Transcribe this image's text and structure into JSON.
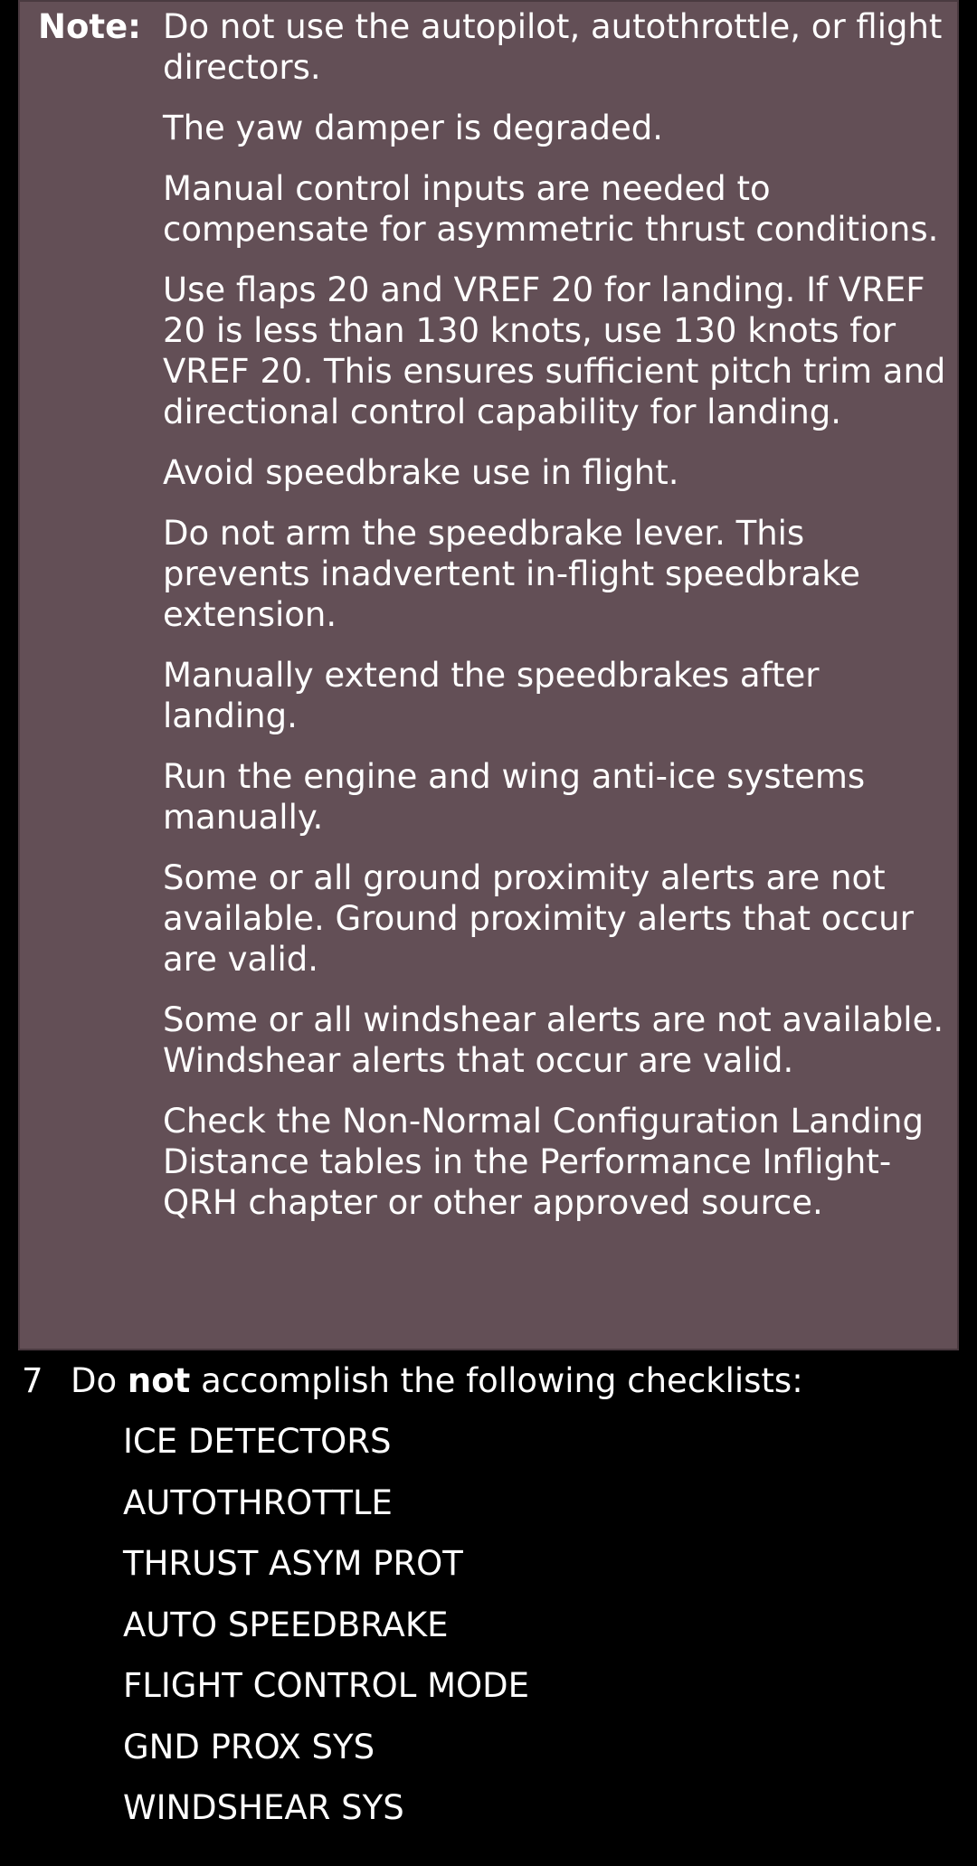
{
  "note": {
    "label": "Note:",
    "items": [
      "Do not use the autopilot, autothrottle, or flight directors.",
      "The yaw damper is degraded.",
      "Manual control inputs are needed to compensate for asymmetric thrust conditions.",
      "Use flaps 20 and VREF 20 for landing. If VREF 20 is less than 130 knots, use 130 knots for VREF 20. This ensures sufficient pitch trim and directional control capability for landing.",
      "Avoid speedbrake use in flight.",
      "Do not arm the speedbrake lever. This prevents inadvertent in-flight speedbrake extension.",
      "Manually extend the speedbrakes after landing.",
      "Run the engine and wing anti-ice systems manually.",
      "Some or all ground proximity alerts are not available. Ground proximity alerts that occur are valid.",
      "Some or all windshear alerts are not available. Windshear alerts that occur are valid.",
      "Check the Non-Normal Configuration Landing Distance tables in the Performance Inflight-QRH chapter or other approved source."
    ]
  },
  "step7": {
    "number": "7",
    "text_before": "Do ",
    "emphasis": "not",
    "text_after": " accomplish the following checklists:",
    "checklists": [
      "ICE DETECTORS",
      "AUTOTHROTTLE",
      "THRUST ASYM PROT",
      "AUTO SPEEDBRAKE",
      "FLIGHT CONTROL MODE",
      "GND PROX SYS",
      "WINDSHEAR SYS"
    ]
  },
  "colors": {
    "note_background": "#634f56",
    "page_background": "#000000",
    "text": "#ffffff"
  }
}
